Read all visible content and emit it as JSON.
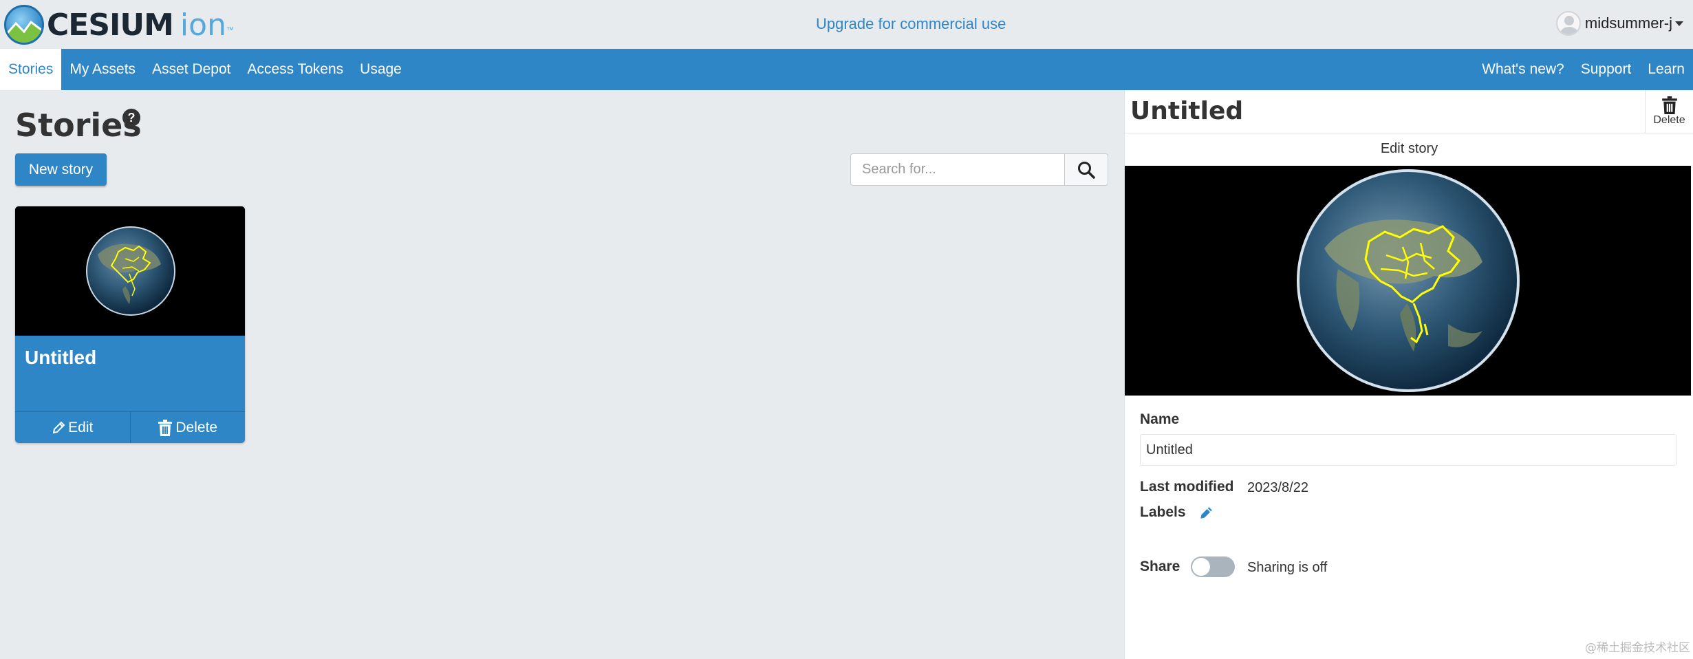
{
  "header": {
    "logo_text": "CESIUM",
    "logo_ion": "ion",
    "logo_tm": "™",
    "upgrade_link": "Upgrade for commercial use",
    "username": "midsummer-j"
  },
  "nav": {
    "left": [
      {
        "label": "Stories",
        "active": true
      },
      {
        "label": "My Assets",
        "active": false
      },
      {
        "label": "Asset Depot",
        "active": false
      },
      {
        "label": "Access Tokens",
        "active": false
      },
      {
        "label": "Usage",
        "active": false
      }
    ],
    "right": [
      {
        "label": "What's new?"
      },
      {
        "label": "Support"
      },
      {
        "label": "Learn"
      }
    ]
  },
  "main": {
    "title": "Stories",
    "help_icon": "question-icon",
    "new_story_label": "New story",
    "search_placeholder": "Search for...",
    "search_icon": "search-icon",
    "cards": [
      {
        "title": "Untitled",
        "edit_label": "Edit",
        "delete_label": "Delete"
      }
    ]
  },
  "detail": {
    "title": "Untitled",
    "delete_label": "Delete",
    "edit_story_label": "Edit story",
    "name_label": "Name",
    "name_value": "Untitled",
    "last_modified_label": "Last modified",
    "last_modified_value": "2023/8/22",
    "labels_label": "Labels",
    "share_label": "Share",
    "share_status": "Sharing is off",
    "share_enabled": false
  },
  "colors": {
    "accent": "#2e86c7",
    "page_bg": "#e7ebee",
    "highlight_yellow": "#ffff00"
  },
  "watermark": "@稀土掘金技术社区"
}
